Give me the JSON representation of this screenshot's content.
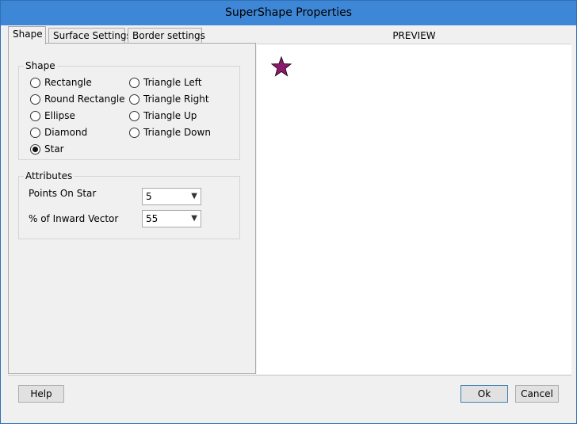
{
  "window": {
    "title": "SuperShape Properties"
  },
  "tabs": [
    {
      "label": "Shape",
      "active": true
    },
    {
      "label": "Surface Settings",
      "active": false
    },
    {
      "label": "Border settings",
      "active": false
    }
  ],
  "shape_group": {
    "caption": "Shape",
    "options": [
      {
        "label": "Rectangle",
        "checked": false
      },
      {
        "label": "Round Rectangle",
        "checked": false
      },
      {
        "label": "Ellipse",
        "checked": false
      },
      {
        "label": "Diamond",
        "checked": false
      },
      {
        "label": "Star",
        "checked": true
      },
      {
        "label": "Triangle Left",
        "checked": false
      },
      {
        "label": "Triangle Right",
        "checked": false
      },
      {
        "label": "Triangle Up",
        "checked": false
      },
      {
        "label": "Triangle Down",
        "checked": false
      }
    ]
  },
  "attributes": {
    "caption": "Attributes",
    "points_on_star": {
      "label": "Points On Star",
      "value": "5"
    },
    "inward_vector": {
      "label": "% of Inward Vector",
      "value": "55"
    }
  },
  "preview": {
    "header": "PREVIEW",
    "star_fill": "#8b1a6d"
  },
  "footer": {
    "help_label": "Help",
    "ok_label": "Ok",
    "cancel_label": "Cancel"
  },
  "colors": {
    "titlebar": "#3d87d6",
    "window_bg": "#f0f0f0",
    "preview_bg": "#ffffff"
  },
  "icons": {
    "dropdown": "chevron-down-icon",
    "preview_shape": "star-icon"
  }
}
